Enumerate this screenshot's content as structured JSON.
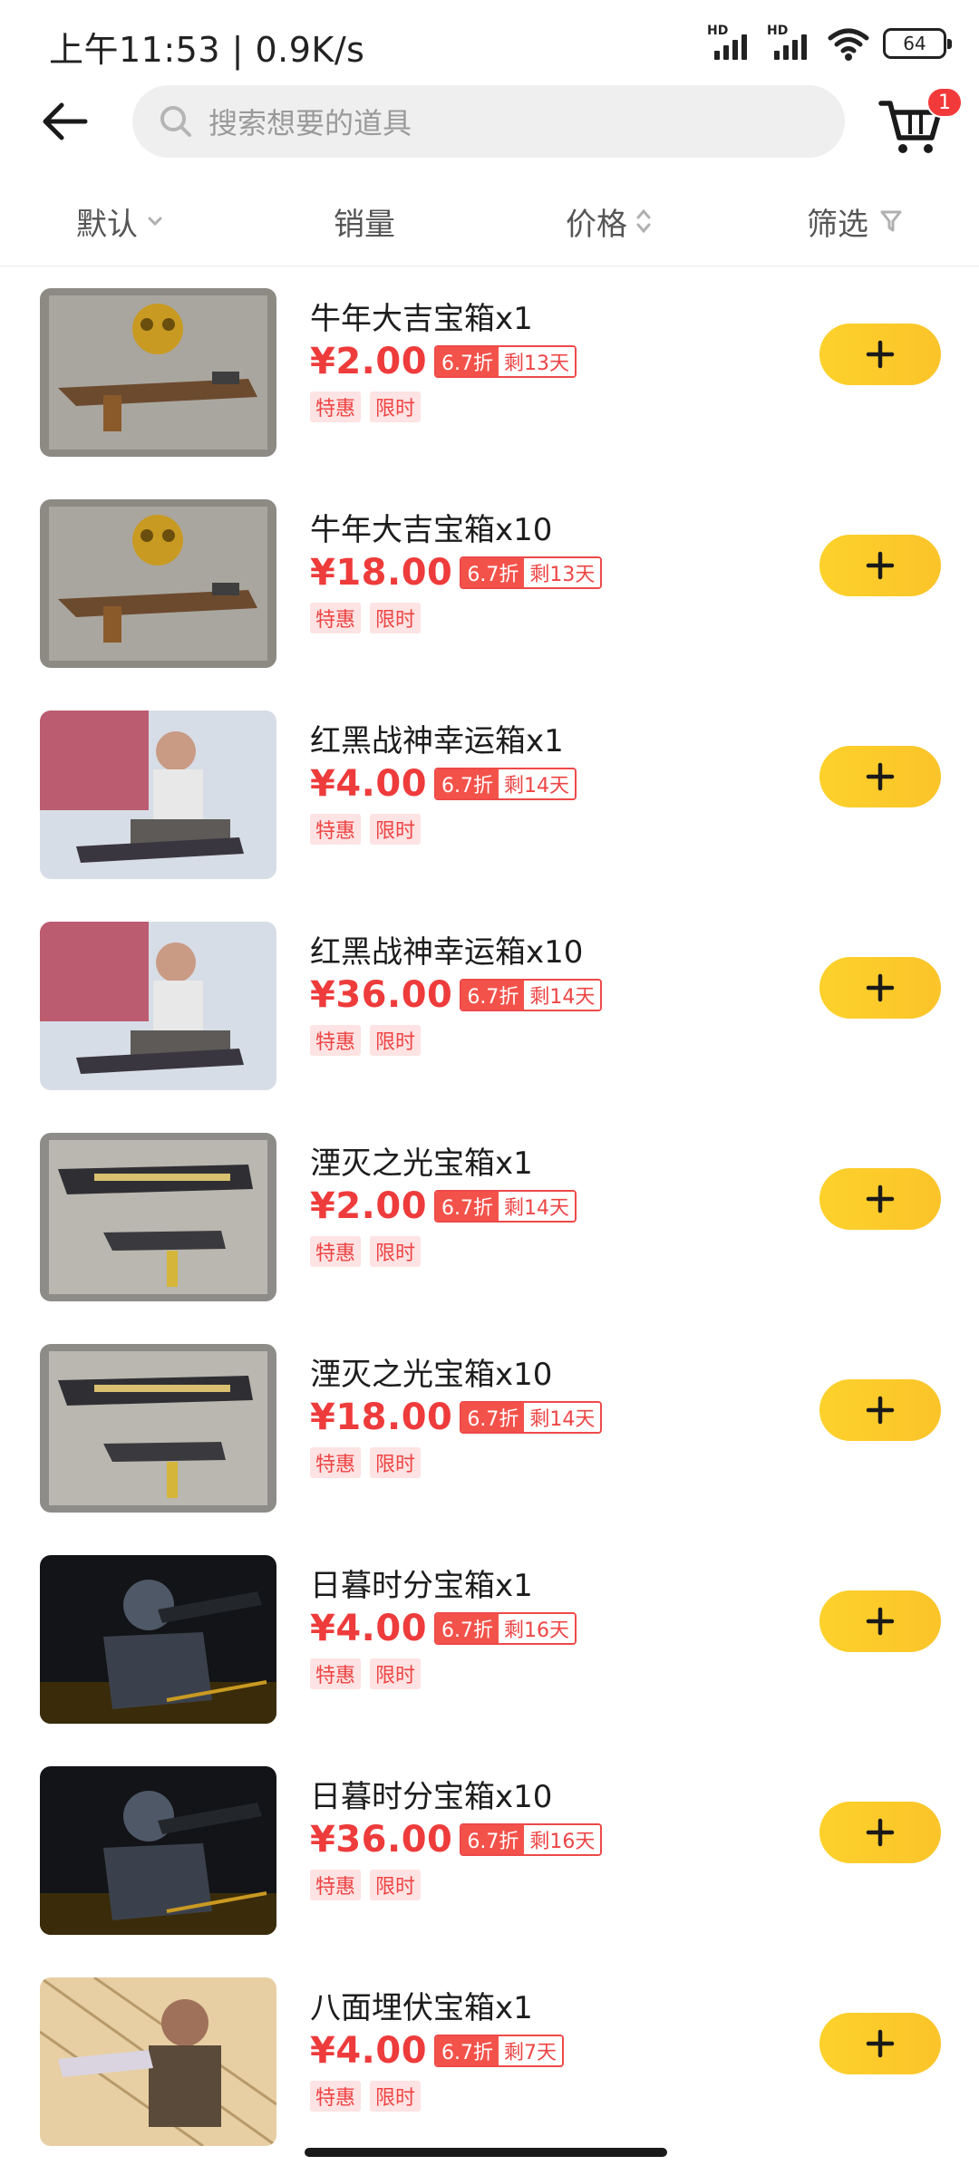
{
  "status_bar": {
    "time": "上午11:53 | 0.9K/s",
    "signal_label": "HD",
    "battery": "64"
  },
  "header": {
    "search_placeholder": "搜索想要的道具",
    "cart_badge": "1",
    "icons": {
      "back": "back-arrow-icon",
      "search": "search-icon",
      "cart": "cart-icon"
    }
  },
  "sort": {
    "default": "默认",
    "sales": "销量",
    "price": "价格",
    "filter": "筛选"
  },
  "colors": {
    "price_red": "#ee3b3b",
    "add_button_yellow": "#fdd12b",
    "badge_red": "#f33a3a"
  },
  "products": [
    {
      "title": "牛年大吉宝箱x1",
      "price": "¥2.00",
      "discount": "6.7折",
      "remaining": "剩13天",
      "tags": [
        "特惠",
        "限时"
      ],
      "image": "gold-skull-rifle"
    },
    {
      "title": "牛年大吉宝箱x10",
      "price": "¥18.00",
      "discount": "6.7折",
      "remaining": "剩13天",
      "tags": [
        "特惠",
        "限时"
      ],
      "image": "gold-skull-rifle"
    },
    {
      "title": "红黑战神幸运箱x1",
      "price": "¥4.00",
      "discount": "6.7折",
      "remaining": "剩14天",
      "tags": [
        "特惠",
        "限时"
      ],
      "image": "red-smoke-soldier"
    },
    {
      "title": "红黑战神幸运箱x10",
      "price": "¥36.00",
      "discount": "6.7折",
      "remaining": "剩14天",
      "tags": [
        "特惠",
        "限时"
      ],
      "image": "red-smoke-soldier"
    },
    {
      "title": "湮灭之光宝箱x1",
      "price": "¥2.00",
      "discount": "6.7折",
      "remaining": "剩14天",
      "tags": [
        "特惠",
        "限时"
      ],
      "image": "silver-gold-guns"
    },
    {
      "title": "湮灭之光宝箱x10",
      "price": "¥18.00",
      "discount": "6.7折",
      "remaining": "剩14天",
      "tags": [
        "特惠",
        "限时"
      ],
      "image": "silver-gold-guns"
    },
    {
      "title": "日暮时分宝箱x1",
      "price": "¥4.00",
      "discount": "6.7折",
      "remaining": "剩16天",
      "tags": [
        "特惠",
        "限时"
      ],
      "image": "dark-masked-soldier"
    },
    {
      "title": "日暮时分宝箱x10",
      "price": "¥36.00",
      "discount": "6.7折",
      "remaining": "剩16天",
      "tags": [
        "特惠",
        "限时"
      ],
      "image": "dark-masked-soldier"
    },
    {
      "title": "八面埋伏宝箱x1",
      "price": "¥4.00",
      "discount": "6.7折",
      "remaining": "剩7天",
      "tags": [
        "特惠",
        "限时"
      ],
      "image": "fence-soldier"
    }
  ]
}
